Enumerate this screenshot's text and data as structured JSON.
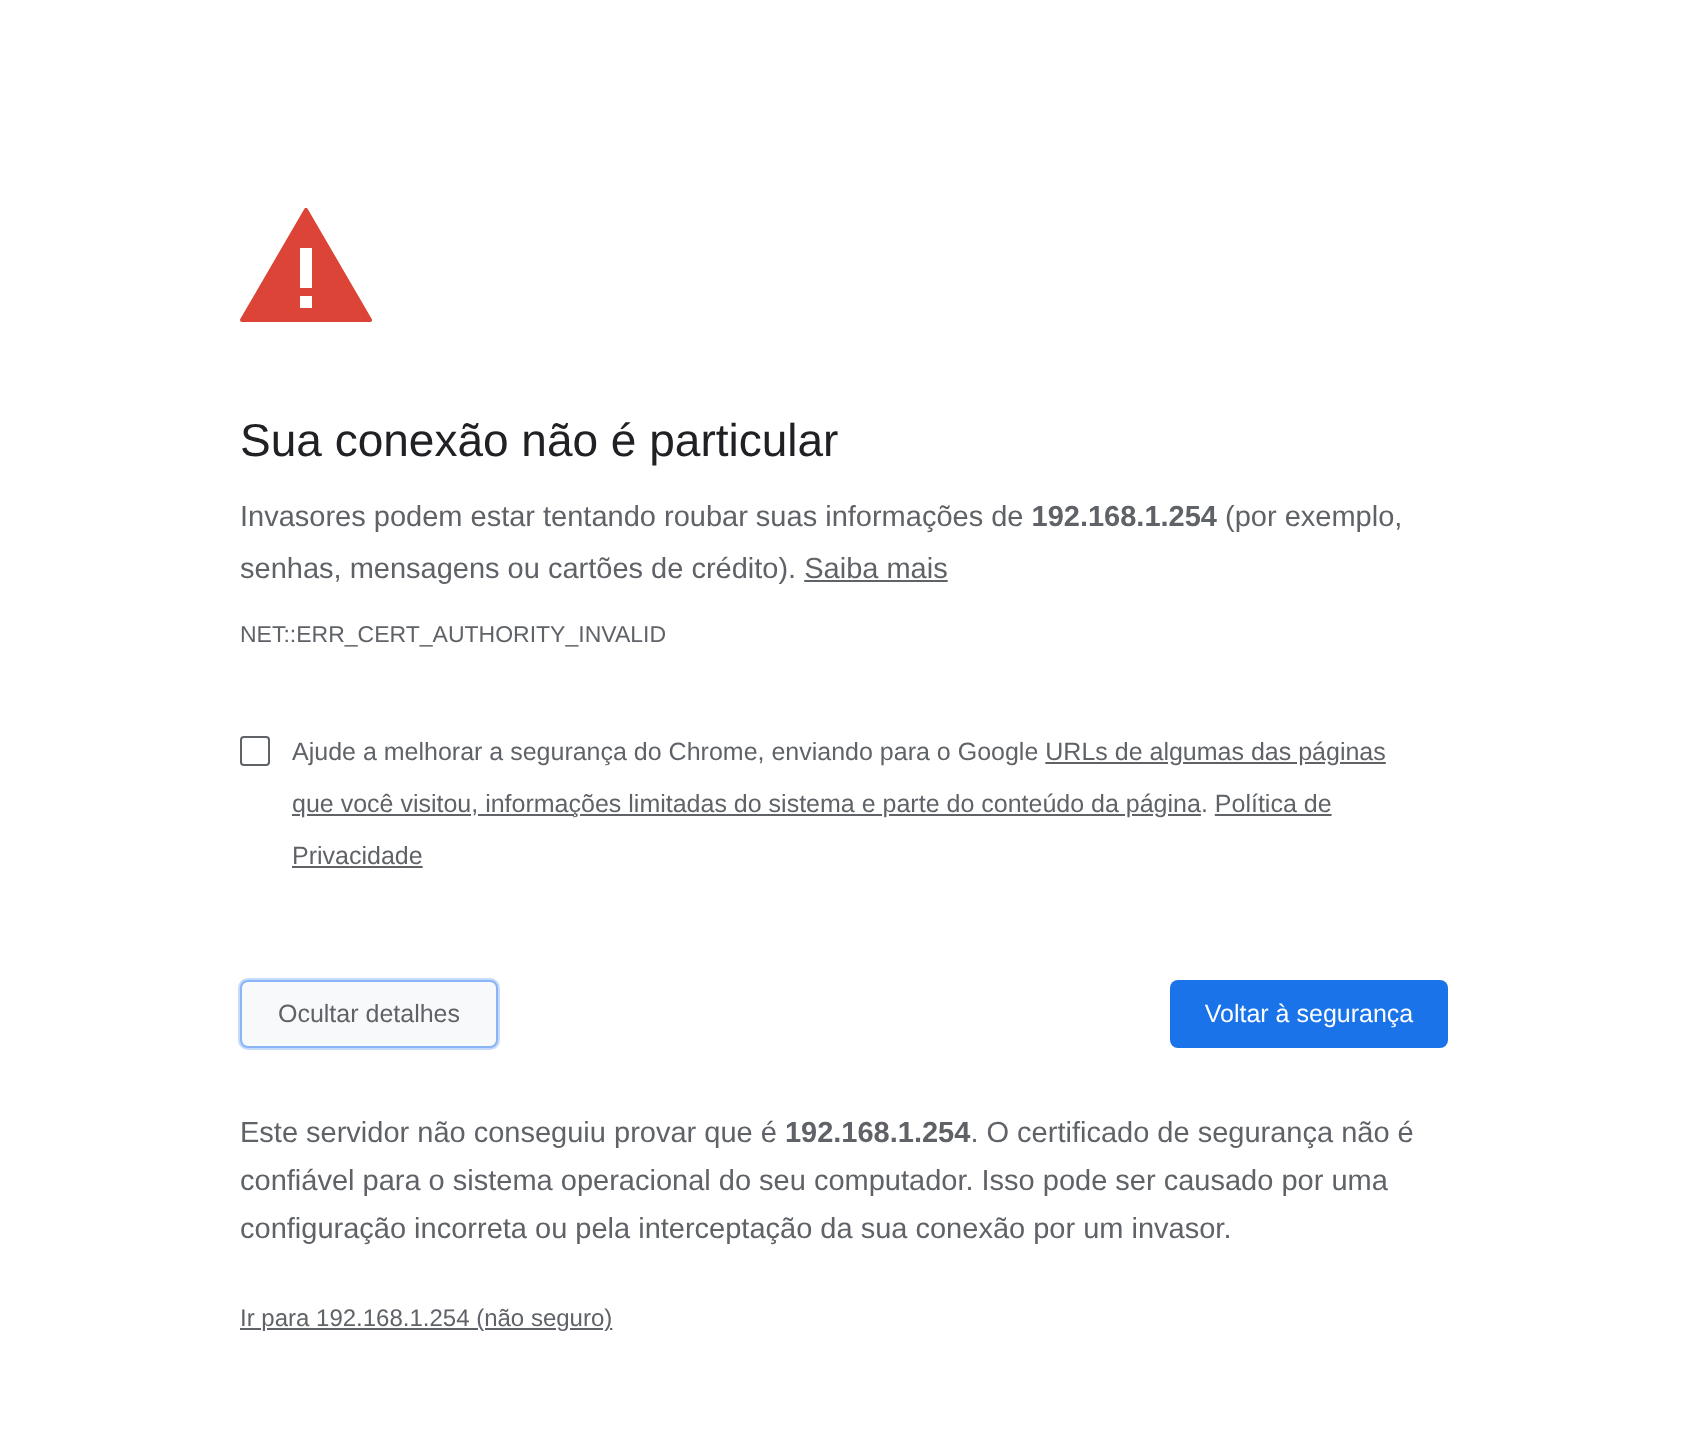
{
  "heading": "Sua conexão não é particular",
  "intro": [
    {
      "kind": "text",
      "text": "Invasores podem estar tentando roubar suas informações de **192.168.1.254** (por exemplo, senhas, mensagens ou cartões de crédito)."
    },
    {
      "kind": "link",
      "text": "Saiba mais"
    }
  ],
  "error_code": "NET::ERR_CERT_AUTHORITY_INVALID",
  "opt_in": {
    "checked": false,
    "segments": [
      {
        "kind": "text",
        "text": "Ajude a melhorar a segurança do Chrome, enviando para o Google"
      },
      {
        "kind": "link",
        "text": "URLs de algumas das páginas"
      },
      {
        "kind": "link",
        "text": "que você visitou, informações limitadas do sistema e parte do conteúdo da página"
      },
      {
        "kind": "text",
        "text": "."
      },
      {
        "kind": "link",
        "text": "Política de"
      },
      {
        "kind": "link",
        "text": "Privacidade"
      }
    ]
  },
  "buttons": [
    {
      "label": "Ocultar detalhes",
      "kind": "secondary"
    },
    {
      "label": "Voltar à segurança",
      "kind": "primary"
    }
  ],
  "details": "Este servidor não conseguiu provar que é **192.168.1.254**. O certificado de segurança não é confiável para o sistema operacional do seu computador. Isso pode ser causado por uma configuração incorreta ou pela interceptação da sua conexão por um invasor.",
  "proceed_link": "Ir para 192.168.1.254 (não seguro)"
}
